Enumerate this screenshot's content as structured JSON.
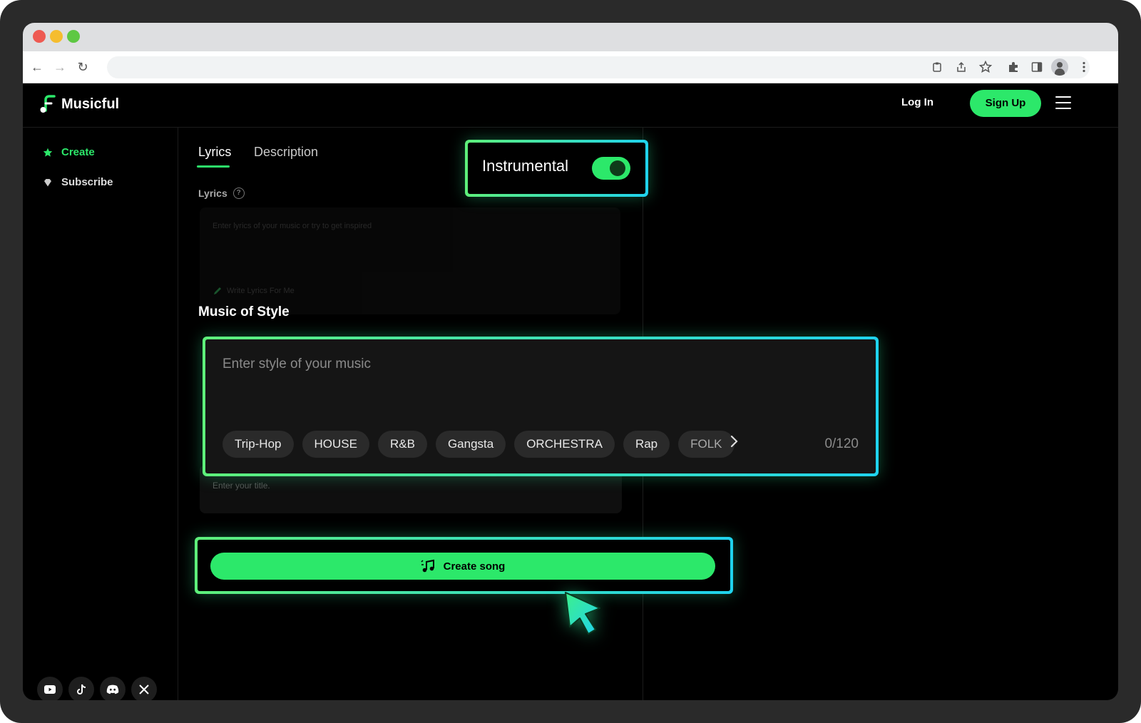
{
  "app": {
    "name": "Musicful",
    "login_label": "Log In",
    "signup_label": "Sign Up"
  },
  "sidebar": {
    "items": [
      {
        "label": "Create",
        "icon": "star-icon",
        "active": true
      },
      {
        "label": "Subscribe",
        "icon": "gem-icon",
        "active": false
      }
    ],
    "socials": [
      "youtube-icon",
      "tiktok-icon",
      "discord-icon",
      "x-icon"
    ]
  },
  "tabs": [
    {
      "label": "Lyrics",
      "active": true
    },
    {
      "label": "Description",
      "active": false
    }
  ],
  "lyrics": {
    "label": "Lyrics",
    "placeholder": "Enter lyrics of your music or try to get inspired",
    "write_button": "Write Lyrics For Me"
  },
  "instrumental": {
    "label": "Instrumental",
    "enabled": true
  },
  "style": {
    "title": "Music of Style",
    "placeholder": "Enter style of your music",
    "chips": [
      "Trip-Hop",
      "HOUSE",
      "R&B",
      "Gangsta",
      "ORCHESTRA",
      "Rap",
      "FOLK"
    ],
    "counter": "0/120"
  },
  "title_field": {
    "placeholder": "Enter your title."
  },
  "create_button": {
    "label": "Create song"
  },
  "colors": {
    "accent": "#2ce86a",
    "highlight_gradient_start": "#5ef07a",
    "highlight_gradient_end": "#1fd3ee"
  }
}
